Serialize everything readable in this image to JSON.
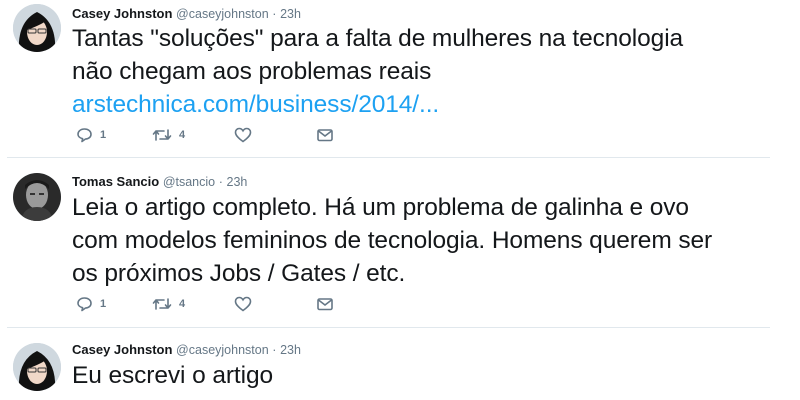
{
  "tweets": [
    {
      "avatar": "avatar-woman",
      "name": "Casey Johnston",
      "handle": "@caseyjohnston",
      "dot": "·",
      "time": "23h",
      "text_lines": [
        "Tantas \"soluções\" para a falta de mulheres na tecnologia",
        "não chegam aos problemas reais"
      ],
      "link": "arstechnica.com/business/2014/...",
      "replies": "1",
      "retweets": "4"
    },
    {
      "avatar": "avatar-man",
      "name": "Tomas Sancio",
      "handle": "@tsancio",
      "dot": "·",
      "time": "23h",
      "text_lines": [
        "Leia o artigo completo. Há um problema de galinha e ovo",
        "com modelos femininos de tecnologia. Homens querem ser",
        "os próximos Jobs / Gates / etc."
      ],
      "replies": "1",
      "retweets": "4"
    },
    {
      "avatar": "avatar-woman",
      "name": "Casey Johnston",
      "handle": "@caseyjohnston",
      "dot": "·",
      "time": "23h",
      "text_lines": [
        "Eu escrevi o artigo"
      ]
    }
  ],
  "icons": {
    "reply": "reply-icon",
    "retweet": "retweet-icon",
    "like": "heart-icon",
    "dm": "envelope-icon"
  },
  "colors": {
    "link": "#1da1f2",
    "meta": "#657786",
    "divider": "#e1e8ed"
  }
}
